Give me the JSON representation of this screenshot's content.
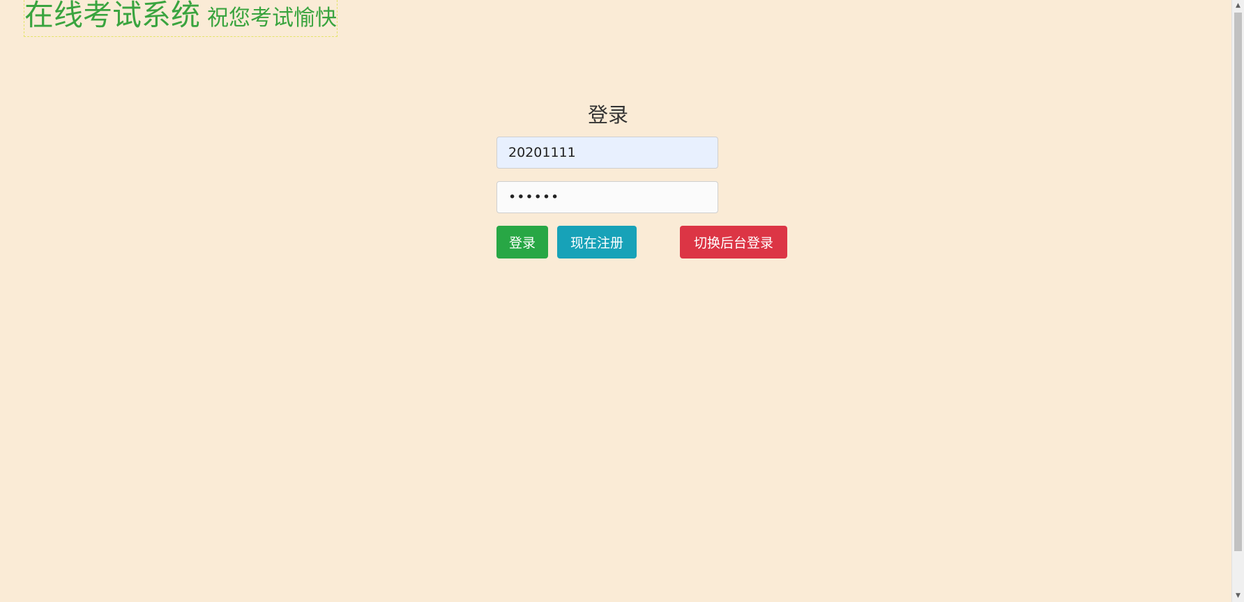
{
  "header": {
    "title": "在线考试系统",
    "subtitle": "祝您考试愉快"
  },
  "login": {
    "heading": "登录",
    "username_value": "20201111",
    "password_value": "••••••",
    "login_button": "登录",
    "register_button": "现在注册",
    "admin_button": "切换后台登录"
  },
  "colors": {
    "background": "#faebd6",
    "brand_green": "#3aa43f",
    "login_button": "#28a745",
    "register_button": "#17a2b8",
    "admin_button": "#dc3545"
  },
  "icons": {
    "scroll_up": "triangle-up-icon",
    "scroll_down": "triangle-down-icon"
  }
}
